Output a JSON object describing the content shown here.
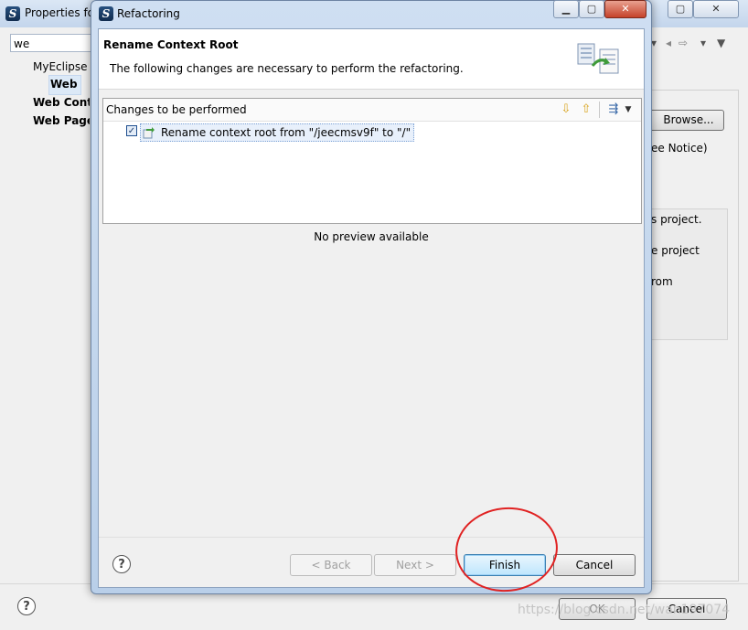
{
  "background_window": {
    "title": "Properties fo",
    "filter_value": "we",
    "tree": {
      "item_myeclipse": "MyEclipse",
      "item_web": "Web",
      "item_web_context": "Web Cont",
      "item_web_page": "Web Page"
    },
    "right": {
      "browse_label": "Browse...",
      "notice_fragment": "ee Notice)",
      "info_line1": "s project.",
      "info_line2": "e project",
      "info_line3": "rom"
    },
    "ok_label": "OK",
    "cancel_label": "Cancel",
    "help_glyph": "?"
  },
  "dialog": {
    "title": "Refactoring",
    "header_title": "Rename Context Root",
    "header_description": "The following changes are necessary to perform the refactoring.",
    "changes_label": "Changes to be performed",
    "changes": [
      {
        "checked": true,
        "text": "Rename context root from \"/jeecmsv9f\" to \"/\""
      }
    ],
    "no_preview": "No preview available",
    "help_glyph": "?",
    "buttons": {
      "back": "< Back",
      "next": "Next >",
      "finish": "Finish",
      "cancel": "Cancel"
    }
  },
  "watermark": "https://blog.csdn.net/wan197074",
  "colors": {
    "annotation_circle": "#e02222",
    "finish_border": "#3c7fb1",
    "title_bar": "#c3d5ec"
  }
}
